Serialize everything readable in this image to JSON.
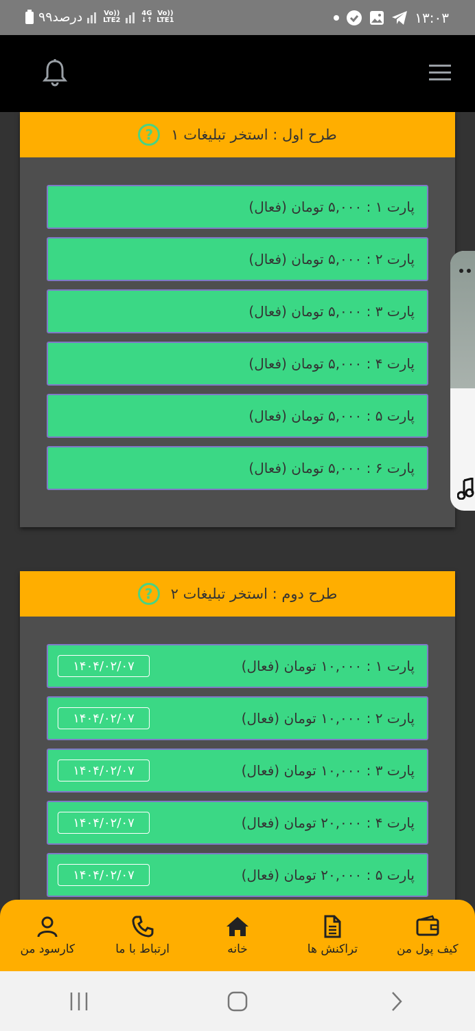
{
  "status": {
    "time": "۱۳:۰۳",
    "battery": "۹۹درصد",
    "net1": "Vo))\nLTE2",
    "net2": "4G Vo))\nLTE1"
  },
  "plan1": {
    "title": "طرح اول : استخر تبلیغات ۱",
    "parts": [
      {
        "label": "پارت ۱ : ۵,۰۰۰ تومان (فعال)"
      },
      {
        "label": "پارت ۲ : ۵,۰۰۰ تومان (فعال)"
      },
      {
        "label": "پارت ۳ : ۵,۰۰۰ تومان (فعال)"
      },
      {
        "label": "پارت ۴ : ۵,۰۰۰ تومان (فعال)"
      },
      {
        "label": "پارت ۵ : ۵,۰۰۰ تومان (فعال)"
      },
      {
        "label": "پارت ۶ : ۵,۰۰۰ تومان (فعال)"
      }
    ]
  },
  "plan2": {
    "title": "طرح دوم : استخر تبلیغات ۲",
    "parts": [
      {
        "label": "پارت ۱ : ۱۰,۰۰۰ تومان (فعال)",
        "date": "۱۴۰۴/۰۲/۰۷"
      },
      {
        "label": "پارت ۲ : ۱۰,۰۰۰ تومان (فعال)",
        "date": "۱۴۰۴/۰۲/۰۷"
      },
      {
        "label": "پارت ۳ : ۱۰,۰۰۰ تومان (فعال)",
        "date": "۱۴۰۴/۰۲/۰۷"
      },
      {
        "label": "پارت ۴ : ۲۰,۰۰۰ تومان (فعال)",
        "date": "۱۴۰۴/۰۲/۰۷"
      },
      {
        "label": "پارت ۵ : ۲۰,۰۰۰ تومان (فعال)",
        "date": "۱۴۰۴/۰۲/۰۷"
      }
    ]
  },
  "nav": {
    "wallet": "کیف پول من",
    "transactions": "تراکنش ها",
    "home": "خانه",
    "contact": "ارتباط با ما",
    "profile": "کارسود من"
  },
  "icons": {
    "menu": "hamburger-menu-icon",
    "bell": "bell-icon",
    "help": "question-icon"
  },
  "colors": {
    "accent": "#ffae00",
    "part_bg": "#3bd885",
    "panel_bg": "#4e4e4e",
    "page_bg": "#333333"
  }
}
